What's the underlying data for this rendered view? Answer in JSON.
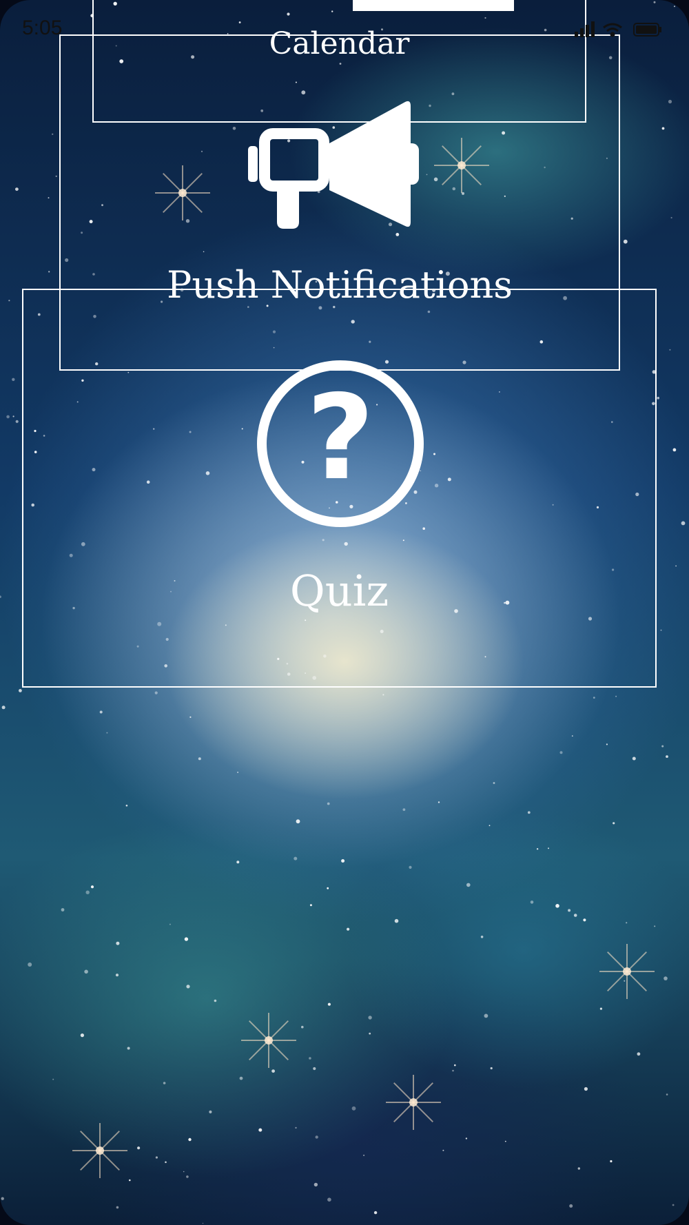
{
  "status_bar": {
    "time": "5:05"
  },
  "menu": {
    "calendar": {
      "label": "Calendar",
      "icon": "calendar-icon"
    },
    "push_notifications": {
      "label": "Push Notifications",
      "icon": "megaphone-icon"
    },
    "quiz": {
      "label": "Quiz",
      "icon": "question-circle-icon"
    }
  },
  "colors": {
    "card_border": "#ffffff",
    "label_text": "#ffffff",
    "background_accent": "#1f5a74"
  }
}
